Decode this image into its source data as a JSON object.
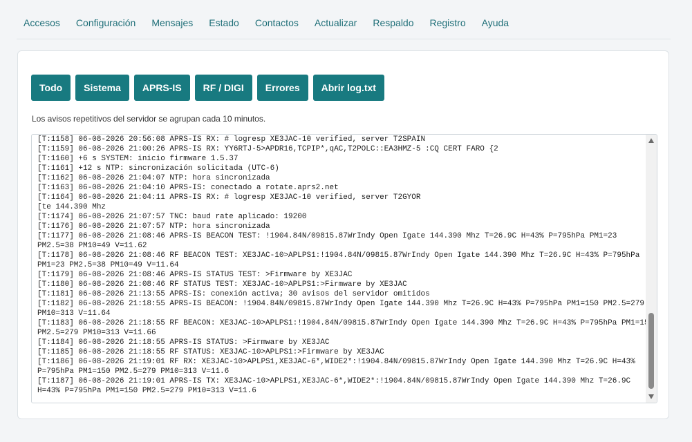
{
  "nav": {
    "items": [
      "Accesos",
      "Configuración",
      "Mensajes",
      "Estado",
      "Contactos",
      "Actualizar",
      "Respaldo",
      "Registro",
      "Ayuda"
    ]
  },
  "filters": {
    "todo": "Todo",
    "sistema": "Sistema",
    "aprs_is": "APRS-IS",
    "rf_digi": "RF / DIGI",
    "errores": "Errores",
    "abrir_log": "Abrir log.txt"
  },
  "note": "Los avisos repetitivos del servidor se agrupan cada 10 minutos.",
  "log": {
    "text": "[T:1158] 06-08-2026 20:56:08 APRS-IS RX: # logresp XE3JAC-10 verified, server T2SPAIN\n[T:1159] 06-08-2026 21:00:26 APRS-IS RX: YY6RTJ-5>APDR16,TCPIP*,qAC,T2POLC::EA3HMZ-5 :CQ CERT FARO {2\n[T:1160] +6 s SYSTEM: inicio firmware 1.5.37\n[T:1161] +12 s NTP: sincronización solicitada (UTC-6)\n[T:1162] 06-08-2026 21:04:07 NTP: hora sincronizada\n[T:1163] 06-08-2026 21:04:10 APRS-IS: conectado a rotate.aprs2.net\n[T:1164] 06-08-2026 21:04:11 APRS-IS RX: # logresp XE3JAC-10 verified, server T2GYOR\n[te 144.390 Mhz\n[T:1174] 06-08-2026 21:07:57 TNC: baud rate aplicado: 19200\n[T:1176] 06-08-2026 21:07:57 NTP: hora sincronizada\n[T:1177] 06-08-2026 21:08:46 APRS-IS BEACON TEST: !1904.84N/09815.87WrIndy Open Igate 144.390 Mhz T=26.9C H=43% P=795hPa PM1=23\nPM2.5=38 PM10=49 V=11.62\n[T:1178] 06-08-2026 21:08:46 RF BEACON TEST: XE3JAC-10>APLPS1:!1904.84N/09815.87WrIndy Open Igate 144.390 Mhz T=26.9C H=43% P=795hPa\nPM1=23 PM2.5=38 PM10=49 V=11.64\n[T:1179] 06-08-2026 21:08:46 APRS-IS STATUS TEST: >Firmware by XE3JAC\n[T:1180] 06-08-2026 21:08:46 RF STATUS TEST: XE3JAC-10>APLPS1:>Firmware by XE3JAC\n[T:1181] 06-08-2026 21:13:55 APRS-IS: conexión activa; 30 avisos del servidor omitidos\n[T:1182] 06-08-2026 21:18:55 APRS-IS BEACON: !1904.84N/09815.87WrIndy Open Igate 144.390 Mhz T=26.9C H=43% P=795hPa PM1=150 PM2.5=279\nPM10=313 V=11.64\n[T:1183] 06-08-2026 21:18:55 RF BEACON: XE3JAC-10>APLPS1:!1904.84N/09815.87WrIndy Open Igate 144.390 Mhz T=26.9C H=43% P=795hPa PM1=150\nPM2.5=279 PM10=313 V=11.66\n[T:1184] 06-08-2026 21:18:55 APRS-IS STATUS: >Firmware by XE3JAC\n[T:1185] 06-08-2026 21:18:55 RF STATUS: XE3JAC-10>APLPS1:>Firmware by XE3JAC\n[T:1186] 06-08-2026 21:19:01 RF RX: XE3JAC-10>APLPS1,XE3JAC-6*,WIDE2*:!1904.84N/09815.87WrIndy Open Igate 144.390 Mhz T=26.9C H=43%\nP=795hPa PM1=150 PM2.5=279 PM10=313 V=11.6\n[T:1187] 06-08-2026 21:19:01 APRS-IS TX: XE3JAC-10>APLPS1,XE3JAC-6*,WIDE2*:!1904.84N/09815.87WrIndy Open Igate 144.390 Mhz T=26.9C\nH=43% P=795hPa PM1=150 PM2.5=279 PM10=313 V=11.6"
  },
  "icons": {
    "scroll_up": "scroll-up-icon",
    "scroll_down": "scroll-down-icon"
  }
}
